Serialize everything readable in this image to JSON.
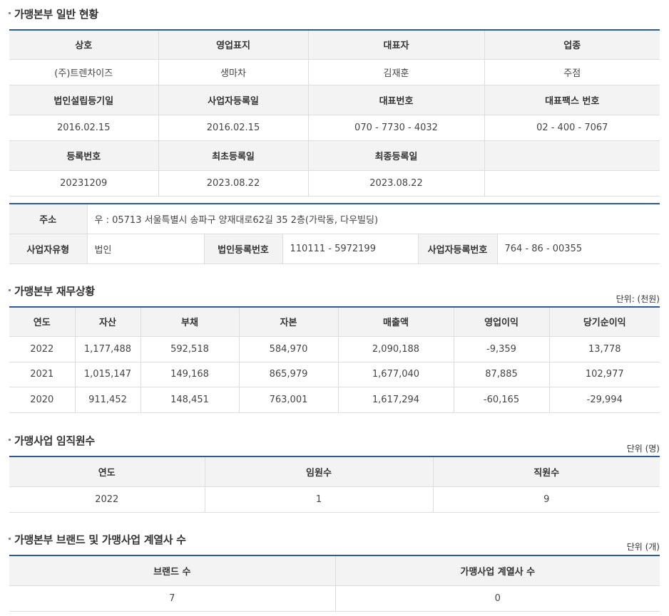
{
  "general": {
    "title": "가맹본부 일반 현황",
    "headers1": [
      "상호",
      "영업표지",
      "대표자",
      "업종"
    ],
    "values1": [
      "(주)트렌차이즈",
      "생마차",
      "김재훈",
      "주점"
    ],
    "headers2": [
      "법인설립등기일",
      "사업자등록일",
      "대표번호",
      "대표팩스 번호"
    ],
    "values2": [
      "2016.02.15",
      "2016.02.15",
      "070 - 7730 - 4032",
      "02 - 400 - 7067"
    ],
    "headers3": [
      "등록번호",
      "최초등록일",
      "최종등록일",
      ""
    ],
    "values3": [
      "20231209",
      "2023.08.22",
      "2023.08.22",
      ""
    ]
  },
  "address": {
    "address_label": "주소",
    "address_value": "우 : 05713 서울특별시 송파구 양재대로62길 35 2층(가락동, 다우빌딩)",
    "biz_type_label": "사업자유형",
    "biz_type_value": "법인",
    "corp_reg_label": "법인등록번호",
    "corp_reg_value": "110111 - 5972199",
    "biz_reg_label": "사업자등록번호",
    "biz_reg_value": "764 - 86 - 00355"
  },
  "finance": {
    "title": "가맹본부 재무상황",
    "unit": "단위: (천원)",
    "headers": [
      "연도",
      "자산",
      "부채",
      "자본",
      "매출액",
      "영업이익",
      "당기순이익"
    ],
    "rows": [
      [
        "2022",
        "1,177,488",
        "592,518",
        "584,970",
        "2,090,188",
        "-9,359",
        "13,778"
      ],
      [
        "2021",
        "1,015,147",
        "149,168",
        "865,979",
        "1,677,040",
        "87,885",
        "102,977"
      ],
      [
        "2020",
        "911,452",
        "148,451",
        "763,001",
        "1,617,294",
        "-60,165",
        "-29,994"
      ]
    ]
  },
  "staff": {
    "title": "가맹사업 임직원수",
    "unit": "단위 (명)",
    "headers": [
      "연도",
      "임원수",
      "직원수"
    ],
    "rows": [
      [
        "2022",
        "1",
        "9"
      ]
    ]
  },
  "brands": {
    "title": "가맹본부 브랜드 및 가맹사업 계열사 수",
    "unit": "단위 (개)",
    "headers": [
      "브랜드 수",
      "가맹사업 계열사 수"
    ],
    "rows": [
      [
        "7",
        "0"
      ]
    ]
  }
}
